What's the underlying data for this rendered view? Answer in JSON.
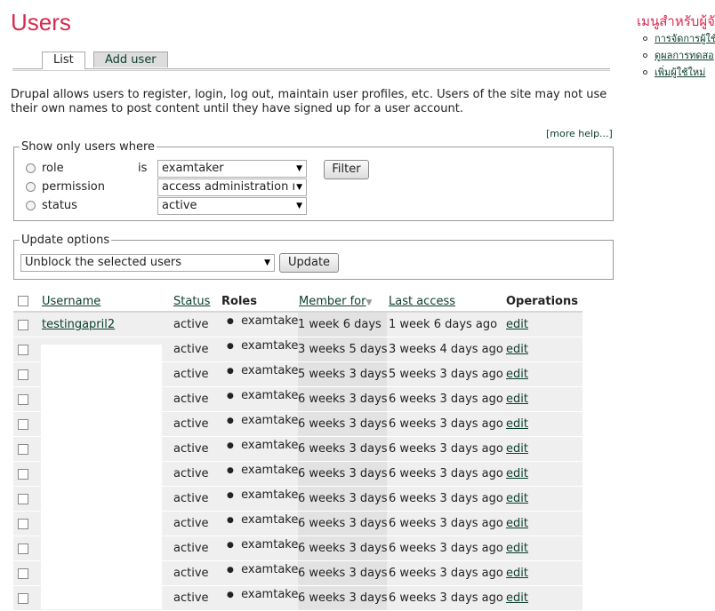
{
  "page": {
    "title": "Users"
  },
  "tabs": [
    {
      "label": "List",
      "active": true
    },
    {
      "label": "Add user",
      "active": false
    }
  ],
  "intro": "Drupal allows users to register, login, log out, maintain user profiles, etc. Users of the site may not use their own names to post content until they have signed up for a user account.",
  "more_help": "[more help...]",
  "filter": {
    "legend": "Show only users where",
    "conditions": [
      {
        "label": "role",
        "operator": "is",
        "value": "examtaker"
      },
      {
        "label": "permission",
        "value": "access administration r"
      },
      {
        "label": "status",
        "value": "active"
      }
    ],
    "button": "Filter"
  },
  "update": {
    "legend": "Update options",
    "selected": "Unblock the selected users",
    "button": "Update"
  },
  "table": {
    "headers": {
      "username": "Username",
      "status": "Status",
      "roles": "Roles",
      "member_for": "Member for",
      "last_access": "Last access",
      "operations": "Operations"
    },
    "sort_icon": "sort-desc-icon",
    "rows": [
      {
        "username": "testingapril2",
        "status": "active",
        "role": "examtaker",
        "member_for": "1 week 6 days",
        "last_access": "1 week 6 days ago",
        "op": "edit"
      },
      {
        "username": "",
        "status": "active",
        "role": "examtaker",
        "member_for": "3 weeks 5 days",
        "last_access": "3 weeks 4 days ago",
        "op": "edit"
      },
      {
        "username": "",
        "status": "active",
        "role": "examtaker",
        "member_for": "5 weeks 3 days",
        "last_access": "5 weeks 3 days ago",
        "op": "edit"
      },
      {
        "username": "",
        "status": "active",
        "role": "examtaker",
        "member_for": "6 weeks 3 days",
        "last_access": "6 weeks 3 days ago",
        "op": "edit"
      },
      {
        "username": "",
        "status": "active",
        "role": "examtaker",
        "member_for": "6 weeks 3 days",
        "last_access": "6 weeks 3 days ago",
        "op": "edit"
      },
      {
        "username": "",
        "status": "active",
        "role": "examtaker",
        "member_for": "6 weeks 3 days",
        "last_access": "6 weeks 3 days ago",
        "op": "edit"
      },
      {
        "username": "",
        "status": "active",
        "role": "examtaker",
        "member_for": "6 weeks 3 days",
        "last_access": "6 weeks 3 days ago",
        "op": "edit"
      },
      {
        "username": "",
        "status": "active",
        "role": "examtaker",
        "member_for": "6 weeks 3 days",
        "last_access": "6 weeks 3 days ago",
        "op": "edit"
      },
      {
        "username": "",
        "status": "active",
        "role": "examtaker",
        "member_for": "6 weeks 3 days",
        "last_access": "6 weeks 3 days ago",
        "op": "edit"
      },
      {
        "username": "",
        "status": "active",
        "role": "examtaker",
        "member_for": "6 weeks 3 days",
        "last_access": "6 weeks 3 days ago",
        "op": "edit"
      },
      {
        "username": "",
        "status": "active",
        "role": "examtaker",
        "member_for": "6 weeks 3 days",
        "last_access": "6 weeks 3 days ago",
        "op": "edit"
      },
      {
        "username": "",
        "status": "active",
        "role": "examtaker",
        "member_for": "6 weeks 3 days",
        "last_access": "6 weeks 3 days ago",
        "op": "edit"
      }
    ]
  },
  "sidebar": {
    "title": "เมนูสำหรับผู้จั",
    "items": [
      {
        "label": "การจัดการผู้ใช้"
      },
      {
        "label": "ดูผลการทดสอ"
      },
      {
        "label": "เพิ่มผู้ใช้ใหม่"
      }
    ]
  },
  "colors": {
    "title": "#d8294f",
    "link": "#0b3d2e",
    "row_bg": "#efefef",
    "sorted_col_bg": "#e4e4e4"
  }
}
